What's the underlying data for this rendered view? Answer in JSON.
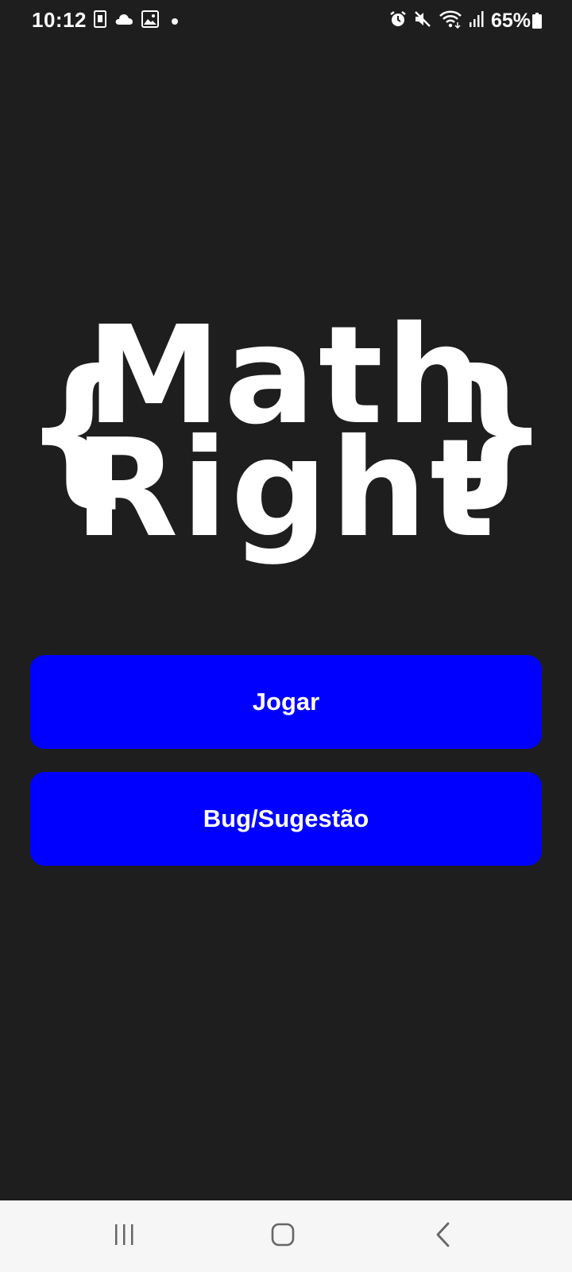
{
  "status_bar": {
    "time": "10:12",
    "battery_percent": "65%",
    "left_icons": [
      "sim-card-icon",
      "cloud-icon",
      "image-icon",
      "notification-dot-icon"
    ],
    "right_icons": [
      "alarm-icon",
      "mute-icon",
      "wifi-icon",
      "signal-icon",
      "battery-icon"
    ]
  },
  "logo": {
    "open_brace": "{",
    "line1": "Math",
    "line2": "Right",
    "close_brace": "}"
  },
  "buttons": {
    "play_label": "Jogar",
    "bug_label": "Bug/Sugestão"
  },
  "colors": {
    "background": "#1e1e1e",
    "button": "#0000fe",
    "text": "#ffffff",
    "nav_bar": "#f6f6f6"
  },
  "nav_bar": {
    "icons": [
      "recents-icon",
      "home-icon",
      "back-icon"
    ]
  }
}
